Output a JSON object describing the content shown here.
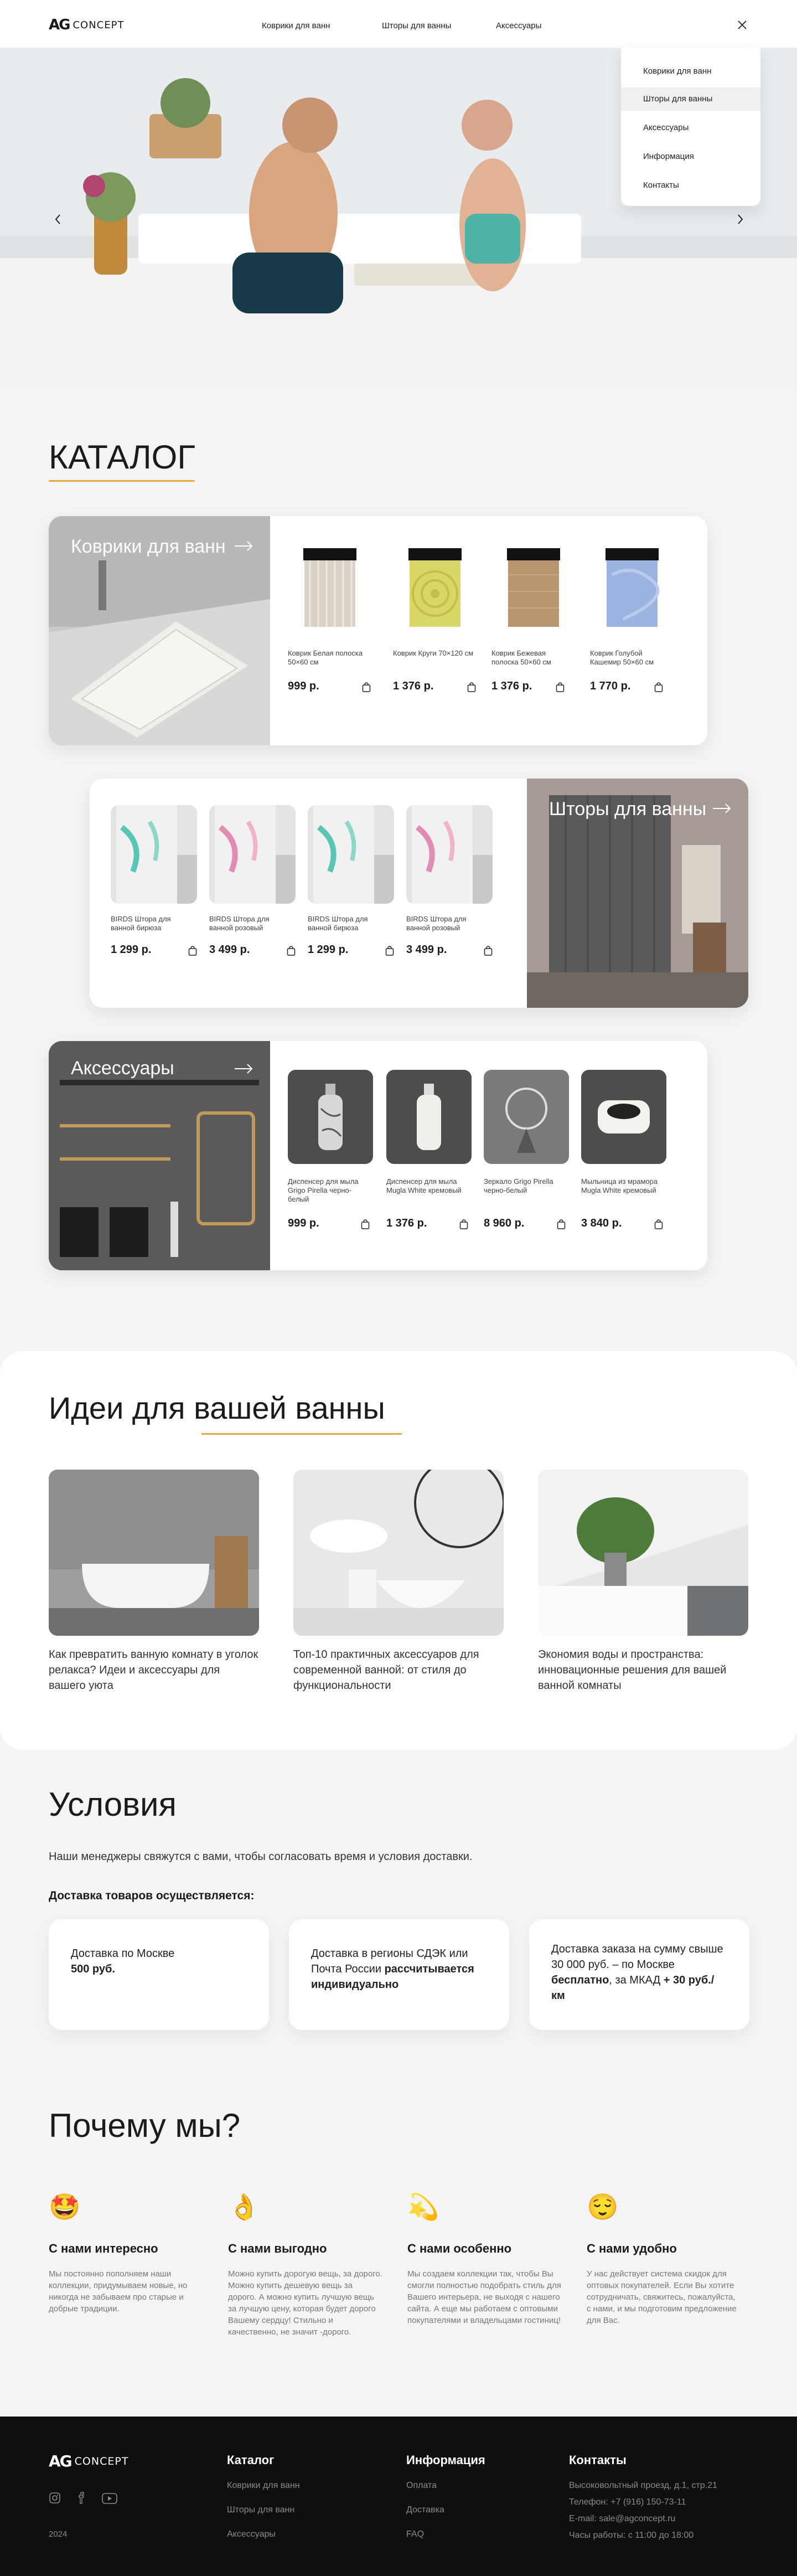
{
  "header": {
    "logo_mark": "AG",
    "logo_word": "CONCEPT",
    "nav": [
      "Коврики для ванн",
      "Шторы для ванны",
      "Аксессуары"
    ],
    "close_icon": "close-icon"
  },
  "menu": {
    "items": [
      "Коврики для ванн",
      "Шторы для ванны",
      "Аксессуары",
      "Информация",
      "Контакты"
    ]
  },
  "catalog": {
    "title": "КАТАЛОГ",
    "rugs": {
      "title": "Коврики для ванн",
      "products": [
        {
          "name": "Коврик Белая полоска 50×60 см",
          "price": "999 р."
        },
        {
          "name": "Коврик Круги 70×120 см",
          "price": "1 376 р."
        },
        {
          "name": "Коврик Бежевая полоска 50×60 см",
          "price": "1 376 р."
        },
        {
          "name": "Коврик Голубой Кашемир 50×60 см",
          "price": "1 770 р."
        }
      ]
    },
    "curtains": {
      "title": "Шторы для ванны",
      "products": [
        {
          "name": "BIRDS Штора для ванной бирюза",
          "price": "1 299 р."
        },
        {
          "name": "BIRDS Штора для ванной розовый",
          "price": "3 499 р."
        },
        {
          "name": "BIRDS Штора для ванной бирюза",
          "price": "1 299 р."
        },
        {
          "name": "BIRDS Штора для ванной розовый",
          "price": "3 499 р."
        }
      ]
    },
    "accessories": {
      "title": "Аксессуары",
      "products": [
        {
          "name": "Диспенсер для мыла Grigo Pirella черно-белый",
          "price": "999 р."
        },
        {
          "name": "Диспенсер для мыла Mugla White кремовый",
          "price": "1 376 р."
        },
        {
          "name": "Зеркало Grigo Pirella черно-белый",
          "price": "8 960 р."
        },
        {
          "name": "Мыльница из мрамора Mugla White кремовый",
          "price": "3 840 р."
        }
      ]
    }
  },
  "ideas": {
    "title_part1": "Идеи для",
    "title_part2": "вашей ванны",
    "items": [
      "Как превратить ванную комнату в уголок релакса? Идеи и аксессуары для вашего уюта",
      "Топ-10 практичных аксессуаров для современной ванной: от стиля до функциональности",
      "Экономия воды и пространства: инновационные решения для вашей ванной комнаты"
    ]
  },
  "conditions": {
    "title": "Условия",
    "intro": "Наши менеджеры свяжутся с вами, чтобы согласовать время и условия доставки.",
    "subtitle": "Доставка товаров осуществляется:",
    "cards": [
      {
        "text": "Доставка по Москве",
        "bold": "500 руб."
      },
      {
        "text": "Доставка в регионы СДЭК или Почта России",
        "bold": "рассчитывается индивидуально"
      },
      {
        "text": "Доставка заказа на сумму свыше 30 000 руб. – по Москве",
        "bold": "бесплатно",
        "text2": ", за МКАД",
        "bold2": "+ 30 руб./км"
      }
    ]
  },
  "why": {
    "title": "Почему мы?",
    "items": [
      {
        "emoji": "🤩",
        "title": "С нами интересно",
        "text": "Мы постоянно пополняем наши коллекции, придумываем новые, но никогда не забываем про старые и добрые традиции."
      },
      {
        "emoji": "👌",
        "title": "С нами выгодно",
        "text": "Можно купить дорогую вещь, за дорого. Можно купить дешевую вещь за дорого. А можно купить лучшую вещь за лучшую цену, которая будет дорого Вашему сердцу! Стильно и качественно, не значит -дорого."
      },
      {
        "emoji": "💫",
        "title": "С нами особенно",
        "text": "Мы создаем коллекции так, чтобы Вы смогли полностью подобрать стиль для Вашего интерьера, не выходя с нашего сайта. А еще мы работаем с оптовыми покупателями и владельцами гостиниц!"
      },
      {
        "emoji": "😌",
        "title": "С нами удобно",
        "text": "У нас действует система скидок для оптовых покупателей. Если Вы хотите сотрудничать, свяжитесь, пожалуйста, с нами, и мы подготовим предложение для Вас."
      }
    ]
  },
  "footer": {
    "year": "2024",
    "col1": {
      "title": "Каталог",
      "links": [
        "Коврики для ванн",
        "Шторы для ванн",
        "Аксессуары"
      ]
    },
    "col2": {
      "title": "Информация",
      "links": [
        "Оплата",
        "Доставка",
        "FAQ"
      ]
    },
    "col3": {
      "title": "Контакты",
      "links": [
        "Высоковольтный проезд, д.1, стр.21",
        "Телефон: +7 (916) 150-73-11",
        "E-mail: sale@agconcept.ru",
        "Часы работы: с 11:00 до 18:00"
      ]
    }
  },
  "colors": {
    "accent": "#e8a83a",
    "footer_bg": "#0f0f0f",
    "page_bg": "#f4f4f5"
  }
}
